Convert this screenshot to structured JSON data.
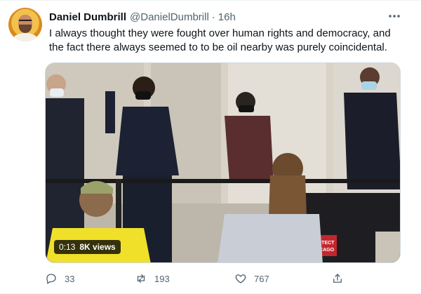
{
  "tweet": {
    "author_name": "Daniel Dumbrill",
    "author_handle": "@DanielDumbrill",
    "separator": "·",
    "time": "16h",
    "text": "I always thought they were fought over human rights and democracy, and the fact there always seemed to to be oil nearby was purely coincidental.",
    "more_icon": "more-horizontal-icon"
  },
  "video": {
    "duration": "0:13",
    "views": "8K views",
    "banner_text": "PROTECT CHICAGO"
  },
  "actions": {
    "reply": {
      "icon": "reply-icon",
      "count": "33"
    },
    "retweet": {
      "icon": "retweet-icon",
      "count": "193"
    },
    "like": {
      "icon": "heart-icon",
      "count": "767"
    },
    "share": {
      "icon": "share-icon"
    }
  },
  "colors": {
    "primary_text": "#0f1419",
    "secondary_text": "#536471",
    "border": "#cfd9de"
  }
}
